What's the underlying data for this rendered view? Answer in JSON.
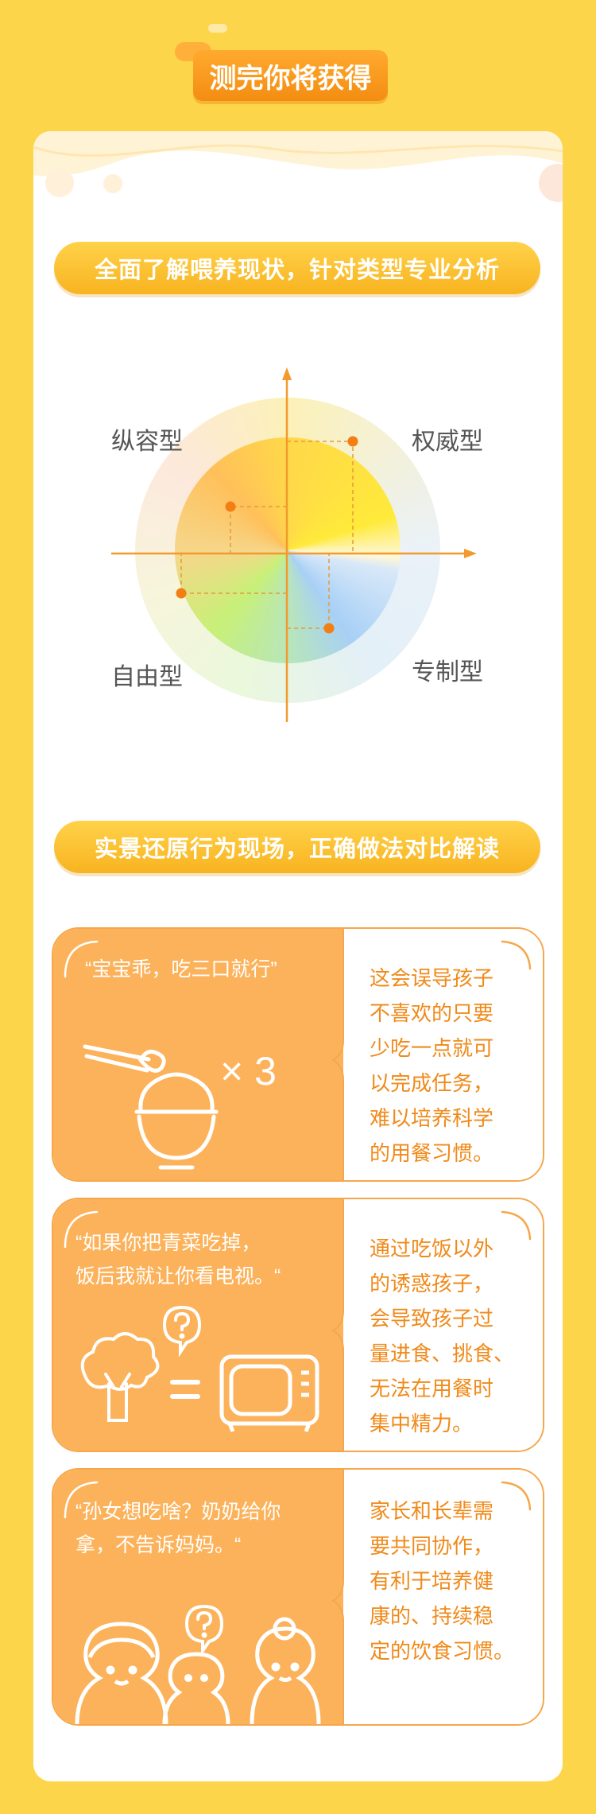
{
  "header": {
    "title": "测完你将获得"
  },
  "section1": {
    "title": "全面了解喂养现状，针对类型专业分析",
    "quadrants": {
      "top_left": "纵容型",
      "top_right": "权威型",
      "bottom_left": "自由型",
      "bottom_right": "专制型"
    }
  },
  "section2": {
    "title": "实景还原行为现场，正确做法对比解读",
    "scenarios": [
      {
        "quote": "“宝宝乖，吃三口就行”",
        "multiplier": "× 3",
        "explanation": [
          "这会误导孩子",
          "不喜欢的只要",
          "少吃一点就可",
          "以完成任务，",
          "难以培养科学",
          "的用餐习惯。"
        ]
      },
      {
        "quote": [
          "“如果你把青菜吃掉，",
          "饭后我就让你看电视。“"
        ],
        "explanation": [
          "通过吃饭以外",
          "的诱惑孩子，",
          "会导致孩子过",
          "量进食、挑食、",
          "无法在用餐时",
          "集中精力。"
        ]
      },
      {
        "quote": [
          "“孙女想吃啥？奶奶给你",
          "拿，不告诉妈妈。“"
        ],
        "explanation": [
          "家长和长辈需",
          "要共同协作，",
          "有利于培养健",
          "康的、持续稳",
          "定的饮食习惯。"
        ]
      }
    ]
  },
  "colors": {
    "background": "#FDD54A",
    "accent": "#F38D12",
    "card_orange": "#FCB25A",
    "text_orange": "#F08A1A"
  }
}
